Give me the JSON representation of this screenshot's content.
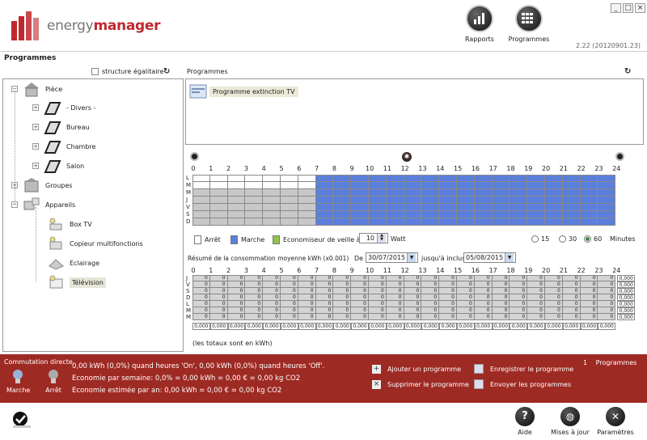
{
  "header": {
    "logo_light": "energy",
    "logo_bold": "manager",
    "btn_reports": "Rapports",
    "btn_programs": "Programmes",
    "version": "2.22 (20120901.23)"
  },
  "page_title": "Programmes",
  "tree": {
    "equal_structure": "structure égalitaire",
    "nodes": {
      "piece": "Pièce",
      "divers": "- Divers -",
      "bureau": "Bureau",
      "chambre": "Chambre",
      "salon": "Salon",
      "groupes": "Groupes",
      "appareils": "Appareils",
      "boxtv": "Box TV",
      "copieur": "Copieur multifonctions",
      "eclairage": "Eclairage",
      "television": "Télévision"
    }
  },
  "programs": {
    "header": "Programmes",
    "item": "Programme extinction TV"
  },
  "schedule": {
    "hours": [
      "0",
      "1",
      "2",
      "3",
      "4",
      "5",
      "6",
      "7",
      "8",
      "9",
      "10",
      "11",
      "12",
      "13",
      "14",
      "15",
      "16",
      "17",
      "18",
      "19",
      "20",
      "21",
      "22",
      "23",
      "24"
    ],
    "days": [
      "L",
      "M",
      "M",
      "J",
      "V",
      "S",
      "D"
    ],
    "on_from_hour": 7,
    "legend_off": "Arrêt",
    "legend_on": "Marche",
    "legend_eco": "Economiseur de veille à",
    "standby_watt_value": "10",
    "watt_unit": "Watt",
    "interval_options": [
      "15",
      "30",
      "60"
    ],
    "interval_selected": "60",
    "interval_unit": "Minutes",
    "colors": {
      "on": "#5b7fdc",
      "off_weekday": "#ffffff",
      "off_weekend": "#c8c8c8",
      "eco": "#8fc44a"
    }
  },
  "summary": {
    "title": "Résumé de la consommation moyenne  kWh (x0.001)",
    "from_label": "De",
    "from_date": "30/07/2015",
    "to_label": "jusqu'à inclus",
    "to_date": "05/08/2015",
    "days": [
      "J",
      "V",
      "S",
      "D",
      "L",
      "M",
      "M"
    ],
    "cell_value": "0",
    "row_total": "0,000",
    "col_total": "0,000",
    "note": "(les totaux sont en kWh)"
  },
  "redbar": {
    "direct_switch": "Commutation directe",
    "btn_on": "Marche",
    "btn_off": "Arrêt",
    "line1": "0,00 kWh (0,0%) quand heures 'On', 0,00 kWh (0,0%) quand heures 'Off'.",
    "line2": "Economie par semaine: 0,0% = 0,00 kWh = 0,00 € = 0,00 kg CO2",
    "line3": "Economie estimée par an: 0,00 kWh = 0,00 € = 0,00 kg CO2",
    "add_program": "Ajouter un programme",
    "delete_program": "Supprimer le programme",
    "save_program": "Enregistrer le programme",
    "send_programs": "Envoyer les programmes",
    "count": "1",
    "count_label": "Programmes"
  },
  "footer": {
    "help": "Aide",
    "updates": "Mises à jour",
    "settings": "Paramètres"
  }
}
